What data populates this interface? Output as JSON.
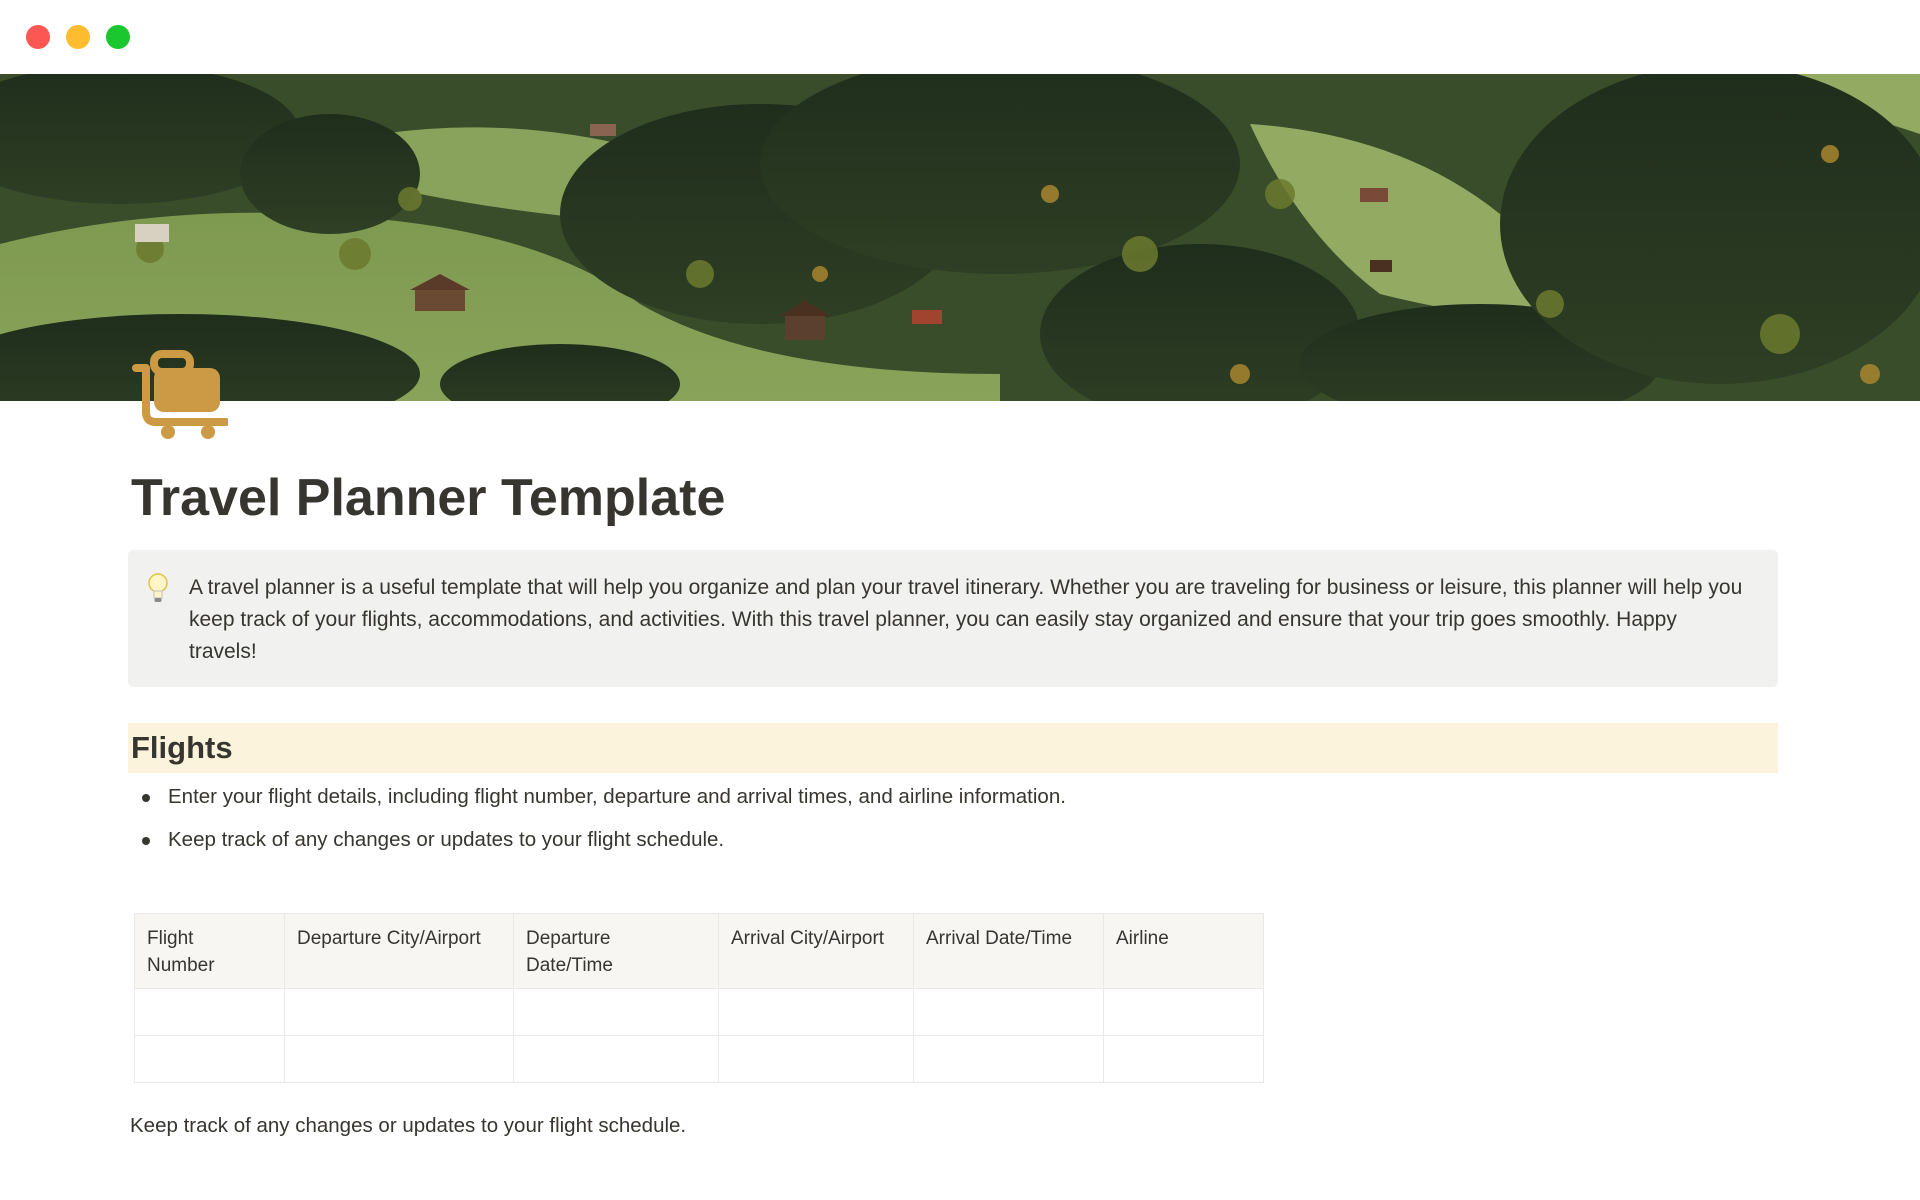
{
  "window": {
    "controls": [
      "close",
      "minimize",
      "zoom"
    ]
  },
  "cover": {
    "description_icon": "landscape-cover-image"
  },
  "page": {
    "icon": "luggage-cart-icon",
    "title": "Travel Planner Template"
  },
  "callout": {
    "icon": "lightbulb-icon",
    "text": "A travel planner is a useful template that will help you organize and plan your travel itinerary. Whether you are traveling for business or leisure, this planner will help you keep track of your flights, accommodations, and activities. With this travel planner, you can easily stay organized and ensure that your trip goes smoothly. Happy travels!"
  },
  "flights": {
    "heading": "Flights",
    "heading_bg": "#fbf3db",
    "bullets": [
      "Enter your flight details, including flight number, departure and arrival times, and airline information.",
      "Keep track of any changes or updates to your flight schedule."
    ],
    "table": {
      "columns": [
        "Flight Number",
        "Departure City/Airport",
        "Departure Date/Time",
        "Arrival City/Airport",
        "Arrival Date/Time",
        "Airline"
      ],
      "rows": [
        [
          "",
          "",
          "",
          "",
          "",
          ""
        ],
        [
          "",
          "",
          "",
          "",
          "",
          ""
        ]
      ]
    },
    "footer": "Keep track of any changes or updates to your flight schedule."
  },
  "colors": {
    "text": "#37352f",
    "callout_bg": "#f1f1ef",
    "icon_accent": "#cc9a45",
    "traffic_close": "#fd5754",
    "traffic_minimize": "#febc2e",
    "traffic_zoom": "#1ac72f"
  }
}
